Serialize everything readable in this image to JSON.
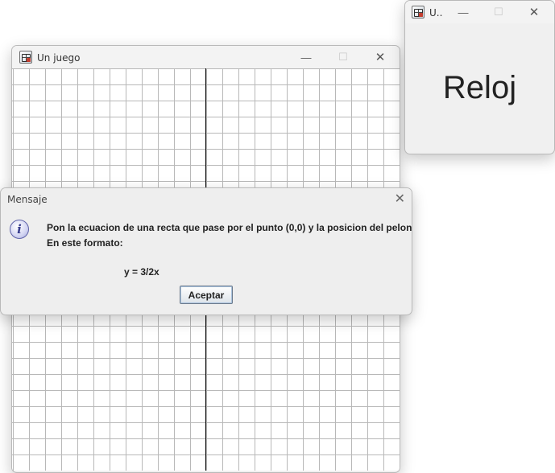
{
  "game_window": {
    "title": "Un juego",
    "minimize_glyph": "—",
    "maximize_glyph": "☐",
    "close_glyph": "✕",
    "icon": "java-app-icon"
  },
  "clock_window": {
    "title": "U..",
    "minimize_glyph": "—",
    "maximize_glyph": "☐",
    "close_glyph": "✕",
    "label": "Reloj",
    "icon": "java-app-icon"
  },
  "dialog": {
    "title": "Mensaje",
    "close_glyph": "✕",
    "icon": "information-icon",
    "icon_glyph": "i",
    "line1": "Pon la ecuacion de una recta que pase por el punto (0,0) y la posicion del pelon",
    "line2": "En este formato:",
    "example": "y = 3/2x",
    "ok_label": "Aceptar"
  },
  "colors": {
    "grid_line": "#b8b8b8",
    "axis_line": "#000000",
    "window_bg": "#f0f0f0"
  }
}
